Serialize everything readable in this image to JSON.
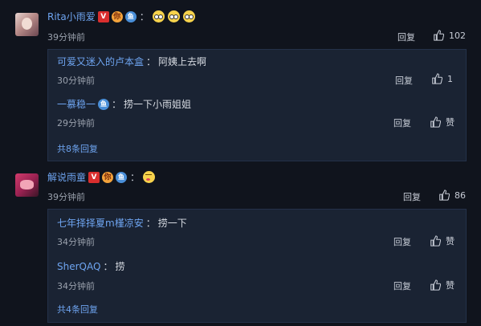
{
  "comments": [
    {
      "username": "Rita小雨爱",
      "time": "39分钟前",
      "reply_label": "回复",
      "likes": "102",
      "emojis": [
        "glasses-emoji",
        "glasses-emoji",
        "glasses-emoji"
      ],
      "replies": [
        {
          "username": "可爱又迷入的卢本盒",
          "colon": "：",
          "text": "阿姨上去啊",
          "time": "30分钟前",
          "reply_label": "回复",
          "likes": "1"
        },
        {
          "username": "一慕稳一",
          "colon": "：",
          "text": "捞一下小雨姐姐",
          "time": "29分钟前",
          "reply_label": "回复",
          "likes": "赞"
        }
      ],
      "more": "共8条回复"
    },
    {
      "username": "解说雨童",
      "time": "39分钟前",
      "reply_label": "回复",
      "likes": "86",
      "emojis": [
        "kiss-emoji"
      ],
      "replies": [
        {
          "username": "七年择择夏m槿凉安",
          "colon": "：",
          "text": "捞一下",
          "time": "34分钟前",
          "reply_label": "回复",
          "likes": "赞"
        },
        {
          "username": "SherQAQ",
          "colon": "：",
          "text": "捞",
          "time": "34分钟前",
          "reply_label": "回复",
          "likes": "赞"
        }
      ],
      "more": "共4条回复"
    }
  ],
  "badges": {
    "v": "V",
    "ni": "你",
    "fish": "鱼"
  },
  "colon": "：",
  "colors": {
    "background": "#10141d",
    "link": "#6ea4f0",
    "reply_box": "#1a2333"
  }
}
